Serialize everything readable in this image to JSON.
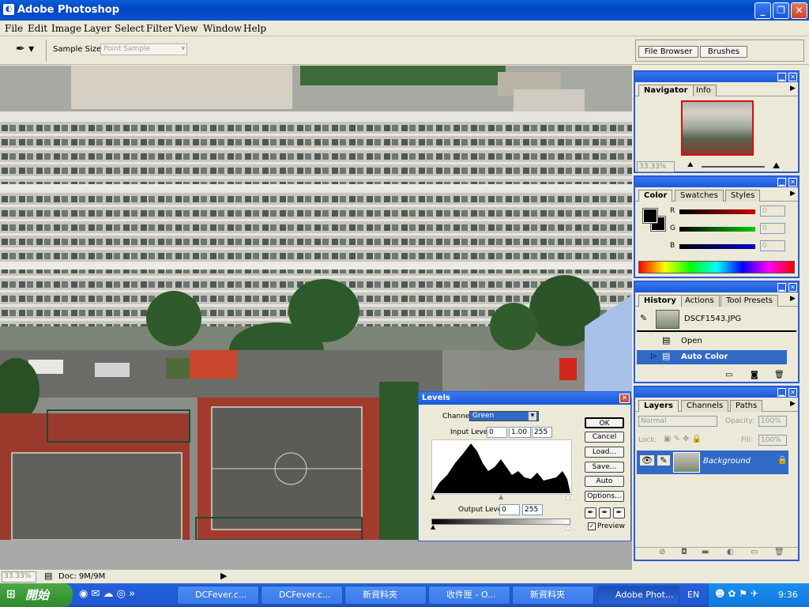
{
  "window": {
    "title": "Adobe Photoshop"
  },
  "menu": [
    "File",
    "Edit",
    "Image",
    "Layer",
    "Select",
    "Filter",
    "View",
    "Window",
    "Help"
  ],
  "options": {
    "sample_size_label": "Sample Size:",
    "sample_size_value": "Point Sample"
  },
  "well_tabs": [
    "File Browser",
    "Brushes"
  ],
  "status": {
    "zoom": "33.33%",
    "doc": "Doc: 9M/9M"
  },
  "navigator": {
    "tabs": [
      "Navigator",
      "Info"
    ],
    "zoom": "33.33%"
  },
  "color": {
    "tabs": [
      "Color",
      "Swatches",
      "Styles"
    ],
    "r_label": "R",
    "g_label": "G",
    "b_label": "B",
    "r_value": "0",
    "g_value": "0",
    "b_value": "0"
  },
  "history": {
    "tabs": [
      "History",
      "Actions",
      "Tool Presets"
    ],
    "snapshot": "DSCF1543.JPG",
    "items": [
      "Open",
      "Auto Color"
    ]
  },
  "layers": {
    "tabs": [
      "Layers",
      "Channels",
      "Paths"
    ],
    "blend": "Normal",
    "opacity_label": "Opacity:",
    "opacity": "100%",
    "lock_label": "Lock:",
    "fill_label": "Fill:",
    "fill": "100%",
    "layer_name": "Background"
  },
  "levels": {
    "title": "Levels",
    "channel_label": "Channel:",
    "channel": "Green",
    "input_label": "Input Levels:",
    "input": [
      "0",
      "1.00",
      "255"
    ],
    "output_label": "Output Levels:",
    "output": [
      "0",
      "255"
    ],
    "buttons": [
      "OK",
      "Cancel",
      "Load...",
      "Save...",
      "Auto",
      "Options..."
    ],
    "preview": "Preview"
  },
  "taskbar": {
    "start": "開始",
    "items": [
      "DCFever.c...",
      "DCFever.c...",
      "新資料夾",
      "收件匣 - O...",
      "新資料夾",
      "Adobe Phot..."
    ],
    "lang": "EN",
    "clock": "9:36"
  }
}
